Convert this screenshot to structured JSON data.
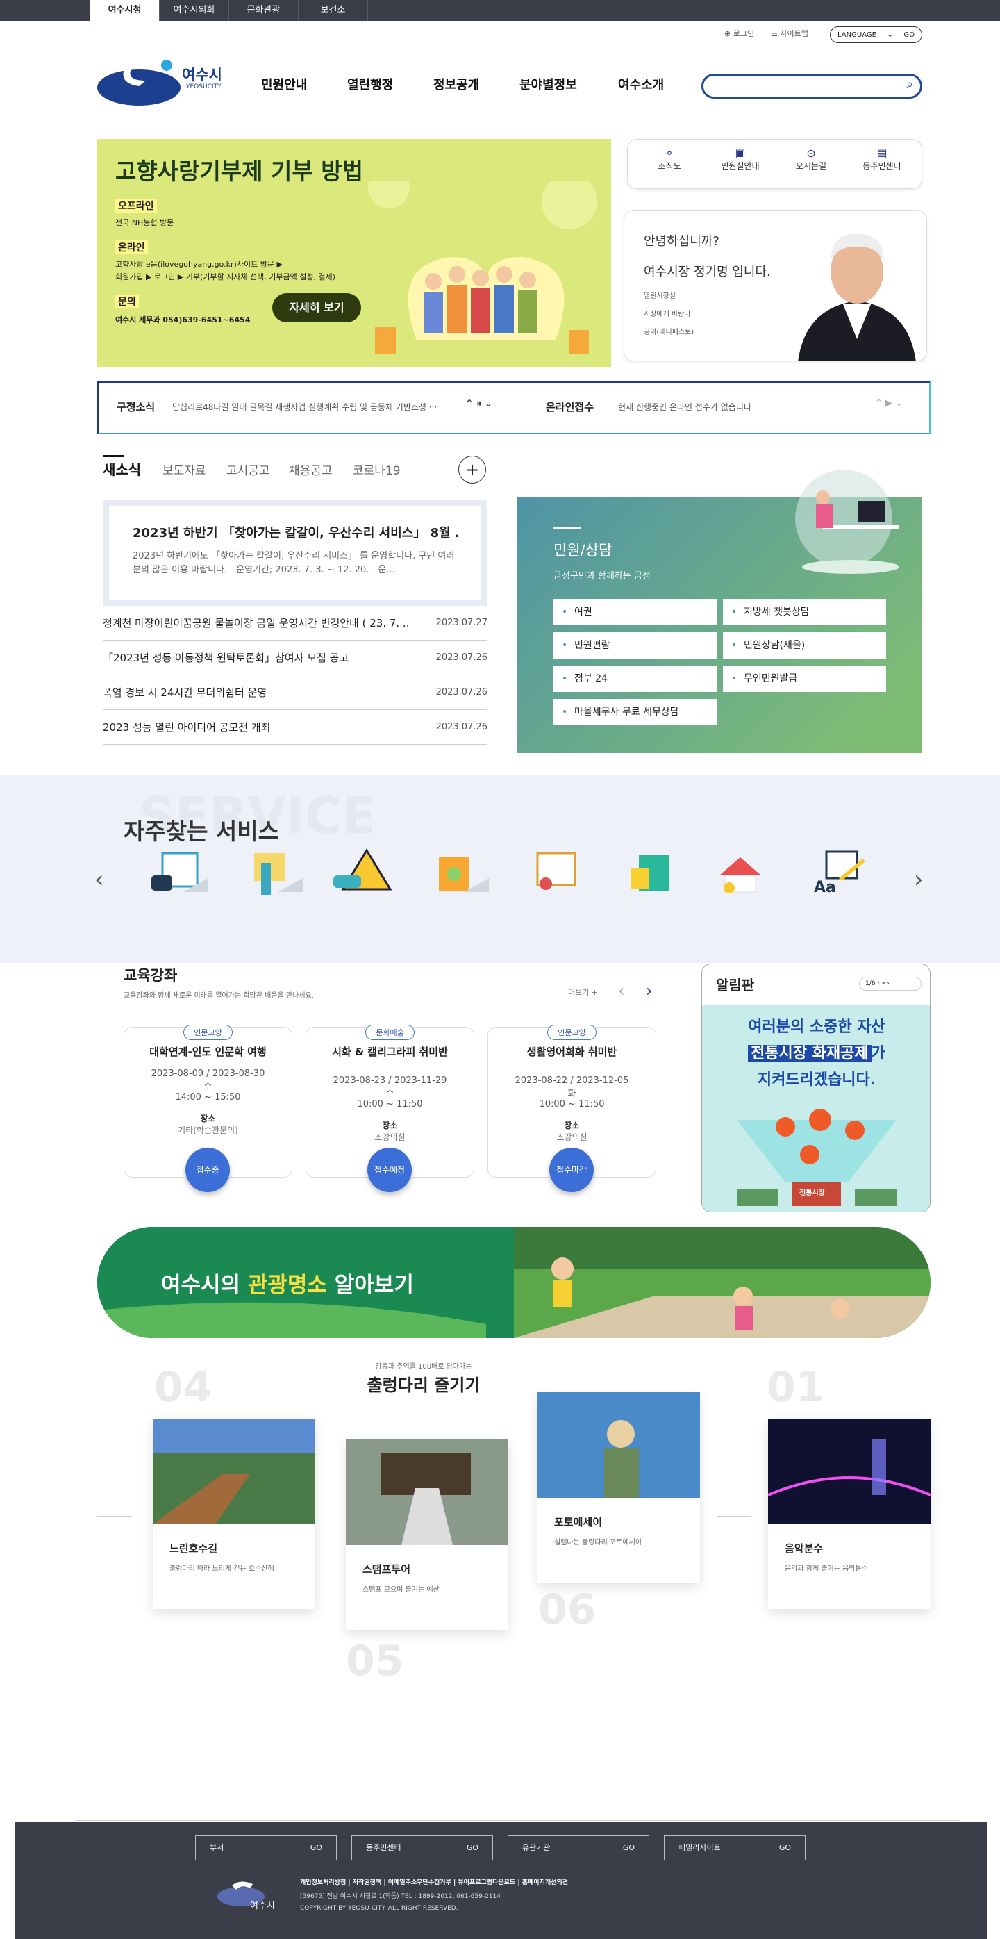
{
  "top_tabs": [
    "여수시청",
    "여수시의회",
    "문화관광",
    "보건소"
  ],
  "util": {
    "login": "로그인",
    "sitemap": "사이트맵",
    "language": "LANGUAGE",
    "go": "GO"
  },
  "logo": {
    "name": "여수시",
    "sub": "YEOSUCITY"
  },
  "gnb": [
    "민원안내",
    "열린행정",
    "정보공개",
    "분야별정보",
    "여수소개"
  ],
  "banner": {
    "title": "고향사랑기부제 기부 방법",
    "l1": "오프라인",
    "d1": "전국 NH농협 방문",
    "l2": "온라인",
    "d2a": "고향사랑 e음(ilovegohyang.go.kr)사이트 방문 ▶",
    "d2b": "회원가입 ▶ 로그인 ▶ 기부(기부할 지자체 선택, 기부금액 설정, 결제)",
    "l3": "문의",
    "d3": "여수시 세무과 054)639-6451~6454",
    "btn": "자세히 보기"
  },
  "quick": [
    "조직도",
    "민원실안내",
    "오시는길",
    "동주민센터"
  ],
  "mayor": {
    "hello": "안녕하십니까?",
    "name": "여수시장 정기명 입니다.",
    "links": [
      "열린시장실",
      "시장에게 바란다",
      "공약(매니페스토)"
    ]
  },
  "notice": {
    "label": "구정소식",
    "text": "답십리로48나길 일대 골목길 재생사업 실행계획 수립 및 공동체 기반조성 ···",
    "label2": "온라인접수",
    "text2": "현재 진행중인 온라인 접수가 없습니다"
  },
  "news": {
    "tabs": [
      "새소식",
      "보도자료",
      "고시공고",
      "채용공고",
      "코로나19"
    ],
    "feature_title": "2023년 하반기 「찾아가는 칼갈이, 우산수리 서비스」 8월 ...",
    "feature_desc": "2023년 하반기에도 「찾아가는 칼갈이, 우산수리 서비스」 를 운영합니다. 구민 여러분의 많은 이용 바랍니다. - 운영기간; 2023. 7. 3. ~ 12. 20. - 운...",
    "rows": [
      {
        "t": "청계천 마장어린이꿈공원 물놀이장 금일 운영시간 변경안내 ( 23. 7. ...",
        "d": "2023.07.27"
      },
      {
        "t": "「2023년 성동 아동정책 원탁토론회」참여자 모집 공고",
        "d": "2023.07.26"
      },
      {
        "t": "폭염 경보 시 24시간 무더위쉼터 운영",
        "d": "2023.07.26"
      },
      {
        "t": "2023 성동 열린 아이디어 공모전 개최",
        "d": "2023.07.26"
      }
    ]
  },
  "civil": {
    "title": "민원/상담",
    "sub": "금정구민과 함께하는 금정",
    "items": [
      "여권",
      "지방세 챗봇상담",
      "민원편람",
      "민원상담(새올)",
      "정부 24",
      "무인민원발급",
      "마을세무사 무료 세무상담"
    ]
  },
  "fav": {
    "title": "자주찾는 서비스",
    "bg": "SERVICE"
  },
  "edu": {
    "title": "교육강좌",
    "desc": "교육강좌와 함께 새로운 미래를 열어가는 희망찬 배움을 만나세요.",
    "more": "더보기",
    "cards": [
      {
        "tag": "인문교양",
        "title": "대학연계-인도 인문학 여행",
        "date": "2023-08-09 / 2023-08-30",
        "day": "수",
        "time": "14:00 ~ 15:50",
        "place_l": "장소",
        "place": "기타(학습관문의)",
        "btn": "접수중"
      },
      {
        "tag": "문화예술",
        "title": "시화 & 캘리그라피 취미반",
        "date": "2023-08-23 / 2023-11-29",
        "day": "수",
        "time": "10:00 ~ 11:50",
        "place_l": "장소",
        "place": "소강의실",
        "btn": "접수예정"
      },
      {
        "tag": "인문교양",
        "title": "생활영어회화 취미반",
        "date": "2023-08-22 / 2023-12-05",
        "day": "화",
        "time": "10:00 ~ 11:50",
        "place_l": "장소",
        "place": "소강의실",
        "btn": "접수마감"
      }
    ]
  },
  "board": {
    "title": "알림판",
    "page": "1/6",
    "l1": "여러분의 소중한 자산",
    "l2a": "전통시장 화재공제",
    "l2b": "가",
    "l3": "지켜드리겠습니다.",
    "sign": "전통시장"
  },
  "tour": {
    "a": "여수시의 ",
    "b": "관광명소",
    "c": " 알아보기"
  },
  "trail": {
    "sub": "감동과 추억을 100배로 담아가는",
    "title": "출렁다리 즐기기",
    "cards": [
      {
        "n": "04",
        "t": "느린호수길",
        "s": "출렁다리 따라 느리게 걷는 호수산책"
      },
      {
        "n": "05",
        "t": "스탬프투어",
        "s": "스탬프 모으며 즐기는 예산"
      },
      {
        "n": "06",
        "t": "포토에세이",
        "s": "설렘나는 출렁다리 포토에세이"
      },
      {
        "n": "01",
        "t": "음악분수",
        "s": "음악과 함께 즐기는 음악분수"
      }
    ]
  },
  "footer": {
    "selects": [
      "부서",
      "동주민센터",
      "유관기관",
      "패밀리사이트"
    ],
    "go": "GO",
    "links": "개인정보처리방침  |  저작권정책  |  이메일주소무단수집거부  |  뷰어프로그램다운로드  |  홈페이지개선의견",
    "addr": "[59675] 전남 여수시 시청로 1(학동) TEL : 1899-2012, 061-659-2114",
    "copy": "COPYRIGHT BY YEOSU-CITY. ALL RIGHT RESERVED.",
    "logo": "여수시"
  }
}
